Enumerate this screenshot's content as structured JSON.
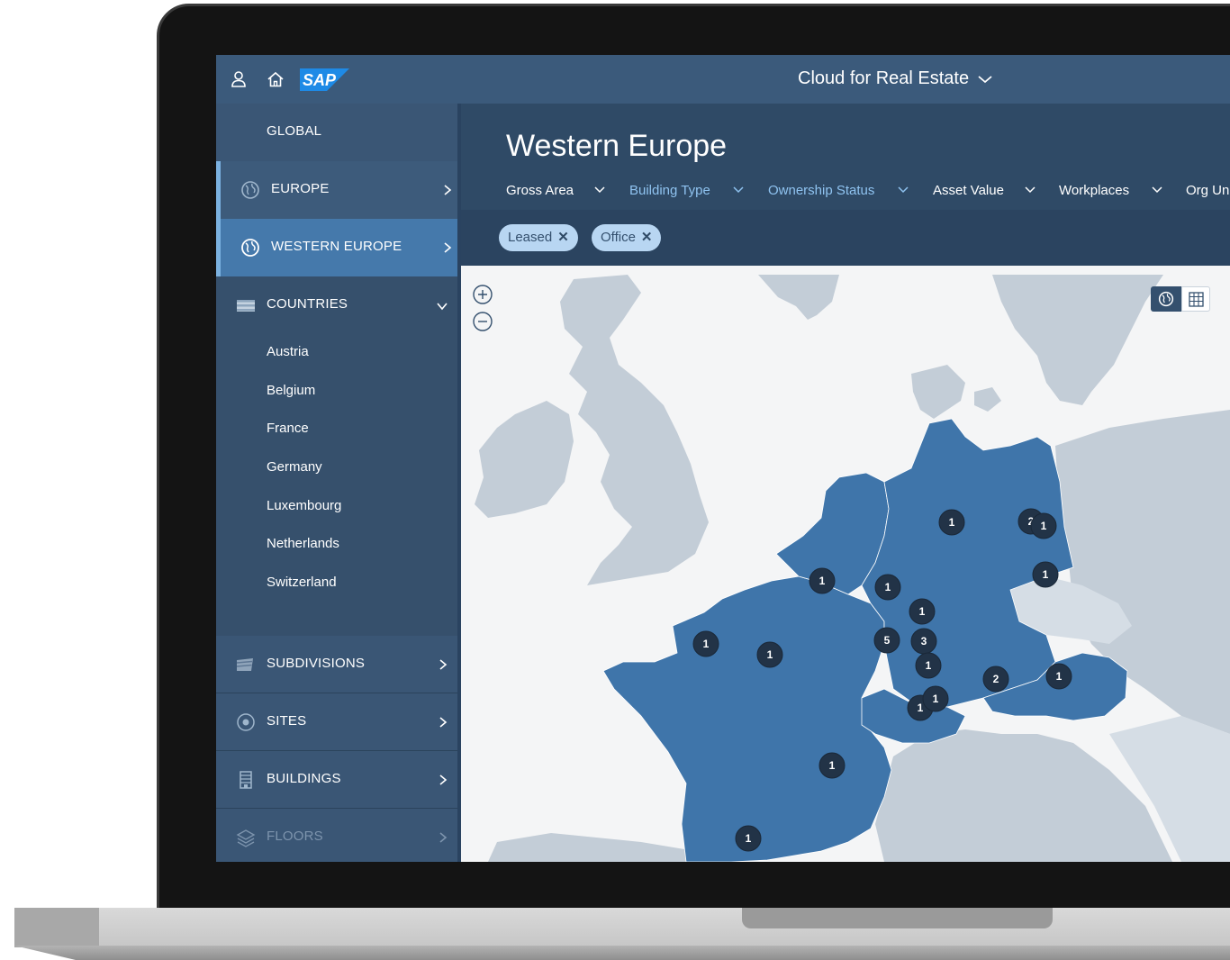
{
  "shell": {
    "user_icon": "person-icon",
    "home_icon": "home-icon",
    "logo_text": "SAP",
    "title": "Cloud for Real Estate"
  },
  "sidebar": {
    "global": "GLOBAL",
    "europe": "EUROPE",
    "western_europe": "WESTERN EUROPE",
    "countries": "COUNTRIES",
    "country_list": [
      "Austria",
      "Belgium",
      "France",
      "Germany",
      "Luxembourg",
      "Netherlands",
      "Switzerland"
    ],
    "subdivisions": "SUBDIVISIONS",
    "sites": "SITES",
    "buildings": "BUILDINGS",
    "floors": "FLOORS"
  },
  "page": {
    "title": "Western Europe"
  },
  "filters": [
    {
      "label": "Gross Area",
      "active": false
    },
    {
      "label": "Building Type",
      "active": true
    },
    {
      "label": "Ownership Status",
      "active": true
    },
    {
      "label": "Asset Value",
      "active": false
    },
    {
      "label": "Workplaces",
      "active": false
    },
    {
      "label": "Org Un",
      "active": false
    }
  ],
  "chips": [
    {
      "label": "Leased",
      "close": "✕"
    },
    {
      "label": "Office",
      "close": "✕"
    }
  ],
  "map": {
    "zoom_in_icon": "plus-circle-icon",
    "zoom_out_icon": "minus-circle-icon",
    "view_globe_icon": "globe-icon",
    "view_table_icon": "table-icon",
    "markers": [
      {
        "count": "1",
        "region": "north-germany"
      },
      {
        "count": "2",
        "region": "berlin"
      },
      {
        "count": "1",
        "region": "berlin-east"
      },
      {
        "count": "1",
        "region": "dresden"
      },
      {
        "count": "1",
        "region": "belgium"
      },
      {
        "count": "1",
        "region": "dusseldorf"
      },
      {
        "count": "1",
        "region": "frankfurt"
      },
      {
        "count": "5",
        "region": "luxembourg"
      },
      {
        "count": "3",
        "region": "mannheim"
      },
      {
        "count": "1",
        "region": "stuttgart"
      },
      {
        "count": "2",
        "region": "munich"
      },
      {
        "count": "1",
        "region": "vienna"
      },
      {
        "count": "1",
        "region": "zurich-a"
      },
      {
        "count": "1",
        "region": "zurich-b"
      },
      {
        "count": "1",
        "region": "normandy"
      },
      {
        "count": "1",
        "region": "paris"
      },
      {
        "count": "1",
        "region": "lyon"
      },
      {
        "count": "1",
        "region": "toulouse"
      }
    ]
  },
  "colors": {
    "shell": "#3b5a7b",
    "sidebar": "#34506e",
    "active_item": "#4579ab",
    "highlight_country": "#3f75aa",
    "other_land": "#c3cdd7",
    "water": "#f4f5f6",
    "marker": "#223347",
    "filter_active": "#8fc3f0"
  }
}
